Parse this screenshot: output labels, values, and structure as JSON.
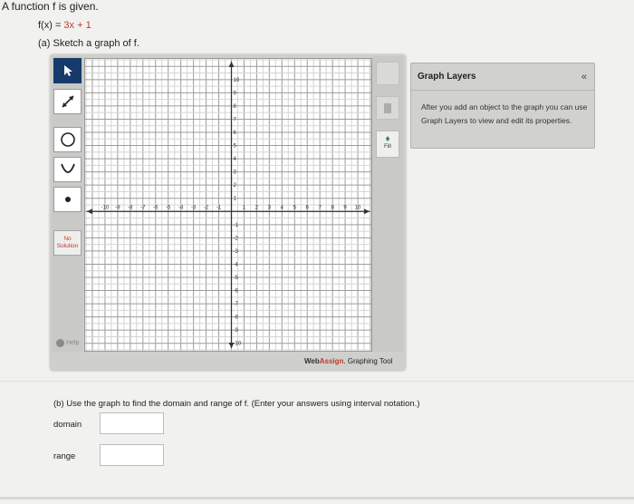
{
  "question": {
    "intro": "A function f is given.",
    "function_lhs": "f(x) = ",
    "function_rhs": "3x + 1",
    "part_a": "(a) Sketch a graph of f.",
    "part_b": "(b) Use the graph to find the domain and range of f. (Enter your answers using interval notation.)",
    "domain_label": "domain",
    "range_label": "range",
    "domain_value": "",
    "range_value": ""
  },
  "toolbar": {
    "tools": [
      "pointer-icon",
      "line-segment-icon",
      "circle-icon",
      "parabola-icon",
      "point-icon"
    ],
    "no_solution_label": "No Solution",
    "help_label": "Help"
  },
  "graph": {
    "x_ticks": [
      "-10",
      "-9",
      "-8",
      "-7",
      "-6",
      "-5",
      "-4",
      "-3",
      "-2",
      "-1",
      "1",
      "2",
      "3",
      "4",
      "5",
      "6",
      "7",
      "8",
      "9",
      "10"
    ],
    "y_ticks": [
      "10",
      "9",
      "8",
      "7",
      "6",
      "5",
      "4",
      "3",
      "2",
      "1",
      "-1",
      "-2",
      "-3",
      "-4",
      "-5",
      "-6",
      "-7",
      "-8",
      "-9",
      "-10"
    ],
    "xlim": [
      -11.5,
      11
    ],
    "ylim": [
      -10.5,
      11.5
    ]
  },
  "right_tools": {
    "fill_label": "Fill"
  },
  "brand": {
    "web": "Web",
    "assign": "Assign",
    "suffix": ". Graphing Tool"
  },
  "layers_panel": {
    "title": "Graph Layers",
    "collapse_glyph": "«",
    "message": "After you add an object to the graph you can use Graph Layers to view and edit its properties."
  }
}
